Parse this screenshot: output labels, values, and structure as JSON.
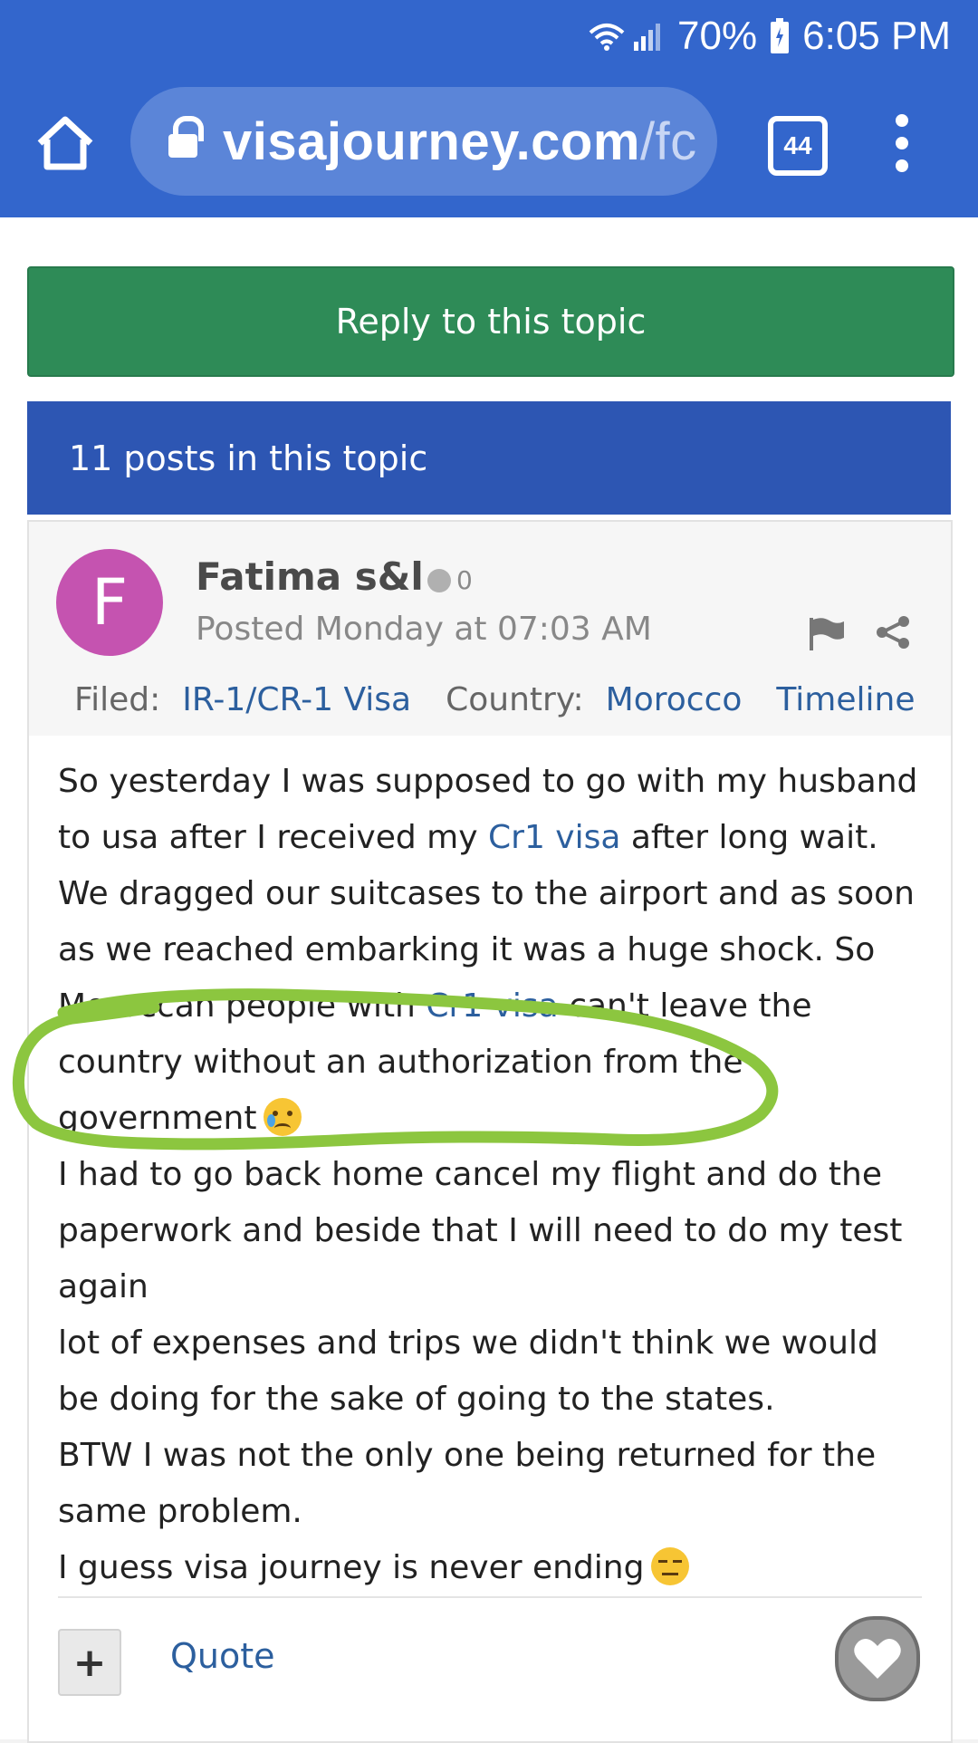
{
  "status_bar": {
    "battery": "70%",
    "time": "6:05 PM"
  },
  "browser": {
    "url_main": "visajourney.com",
    "url_rest": "/fc",
    "tab_count": "44"
  },
  "actions": {
    "reply_label": "Reply to this topic"
  },
  "topic": {
    "posts_count_label": "11 posts in this topic"
  },
  "post": {
    "avatar_letter": "F",
    "author": "Fatima s&l",
    "reputation": "0",
    "posted": "Posted Monday at 07:03 AM",
    "filed_label": "Filed:",
    "filed_value": "IR-1/CR-1 Visa",
    "country_label": "Country:",
    "country_value": "Morocco",
    "timeline_label": "Timeline",
    "body": {
      "p1_a": "So yesterday I was supposed to go with my husband to usa after I received my ",
      "p1_link": "Cr1 visa",
      "p1_b": " after long wait. We dragged our suitcases to the airport and as soon as we reached embarking it was a huge shock. So Moroccan people with ",
      "p1_link2": "Cr1 visa",
      "p1_c": " can't leave the country without an authorization from the government",
      "p2": "I had to go back home cancel my flight and do the paperwork and beside that I will need to do my test again",
      "p3": "lot of expenses and trips we didn't think we would be doing for the sake of going to the states.",
      "p4": "BTW I was not the only one being returned for the same problem.",
      "p5": "I guess visa journey is never ending"
    },
    "emoji_1": "crying-face",
    "emoji_2": "expressionless-face",
    "quote_label": "Quote",
    "plus_label": "+"
  },
  "colors": {
    "chrome_blue": "#3366cc",
    "reply_green": "#2e8b57",
    "posts_bar_blue": "#2d56b3",
    "avatar_purple": "#c553b0",
    "link_blue": "#2c5f9e",
    "annotation_green": "#8cc63f"
  }
}
